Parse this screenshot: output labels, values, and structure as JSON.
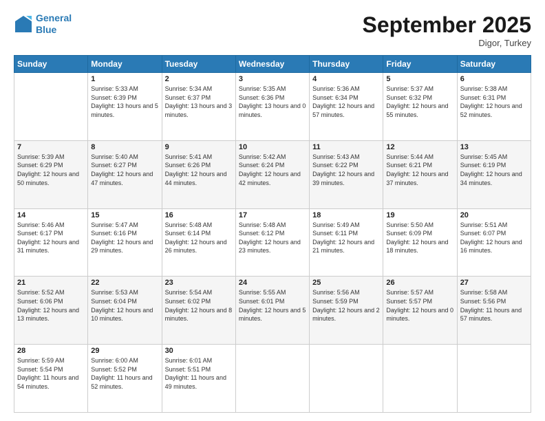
{
  "header": {
    "logo_line1": "General",
    "logo_line2": "Blue",
    "month": "September 2025",
    "location": "Digor, Turkey"
  },
  "weekdays": [
    "Sunday",
    "Monday",
    "Tuesday",
    "Wednesday",
    "Thursday",
    "Friday",
    "Saturday"
  ],
  "weeks": [
    [
      {
        "day": "",
        "sunrise": "",
        "sunset": "",
        "daylight": ""
      },
      {
        "day": "1",
        "sunrise": "Sunrise: 5:33 AM",
        "sunset": "Sunset: 6:39 PM",
        "daylight": "Daylight: 13 hours and 5 minutes."
      },
      {
        "day": "2",
        "sunrise": "Sunrise: 5:34 AM",
        "sunset": "Sunset: 6:37 PM",
        "daylight": "Daylight: 13 hours and 3 minutes."
      },
      {
        "day": "3",
        "sunrise": "Sunrise: 5:35 AM",
        "sunset": "Sunset: 6:36 PM",
        "daylight": "Daylight: 13 hours and 0 minutes."
      },
      {
        "day": "4",
        "sunrise": "Sunrise: 5:36 AM",
        "sunset": "Sunset: 6:34 PM",
        "daylight": "Daylight: 12 hours and 57 minutes."
      },
      {
        "day": "5",
        "sunrise": "Sunrise: 5:37 AM",
        "sunset": "Sunset: 6:32 PM",
        "daylight": "Daylight: 12 hours and 55 minutes."
      },
      {
        "day": "6",
        "sunrise": "Sunrise: 5:38 AM",
        "sunset": "Sunset: 6:31 PM",
        "daylight": "Daylight: 12 hours and 52 minutes."
      }
    ],
    [
      {
        "day": "7",
        "sunrise": "Sunrise: 5:39 AM",
        "sunset": "Sunset: 6:29 PM",
        "daylight": "Daylight: 12 hours and 50 minutes."
      },
      {
        "day": "8",
        "sunrise": "Sunrise: 5:40 AM",
        "sunset": "Sunset: 6:27 PM",
        "daylight": "Daylight: 12 hours and 47 minutes."
      },
      {
        "day": "9",
        "sunrise": "Sunrise: 5:41 AM",
        "sunset": "Sunset: 6:26 PM",
        "daylight": "Daylight: 12 hours and 44 minutes."
      },
      {
        "day": "10",
        "sunrise": "Sunrise: 5:42 AM",
        "sunset": "Sunset: 6:24 PM",
        "daylight": "Daylight: 12 hours and 42 minutes."
      },
      {
        "day": "11",
        "sunrise": "Sunrise: 5:43 AM",
        "sunset": "Sunset: 6:22 PM",
        "daylight": "Daylight: 12 hours and 39 minutes."
      },
      {
        "day": "12",
        "sunrise": "Sunrise: 5:44 AM",
        "sunset": "Sunset: 6:21 PM",
        "daylight": "Daylight: 12 hours and 37 minutes."
      },
      {
        "day": "13",
        "sunrise": "Sunrise: 5:45 AM",
        "sunset": "Sunset: 6:19 PM",
        "daylight": "Daylight: 12 hours and 34 minutes."
      }
    ],
    [
      {
        "day": "14",
        "sunrise": "Sunrise: 5:46 AM",
        "sunset": "Sunset: 6:17 PM",
        "daylight": "Daylight: 12 hours and 31 minutes."
      },
      {
        "day": "15",
        "sunrise": "Sunrise: 5:47 AM",
        "sunset": "Sunset: 6:16 PM",
        "daylight": "Daylight: 12 hours and 29 minutes."
      },
      {
        "day": "16",
        "sunrise": "Sunrise: 5:48 AM",
        "sunset": "Sunset: 6:14 PM",
        "daylight": "Daylight: 12 hours and 26 minutes."
      },
      {
        "day": "17",
        "sunrise": "Sunrise: 5:48 AM",
        "sunset": "Sunset: 6:12 PM",
        "daylight": "Daylight: 12 hours and 23 minutes."
      },
      {
        "day": "18",
        "sunrise": "Sunrise: 5:49 AM",
        "sunset": "Sunset: 6:11 PM",
        "daylight": "Daylight: 12 hours and 21 minutes."
      },
      {
        "day": "19",
        "sunrise": "Sunrise: 5:50 AM",
        "sunset": "Sunset: 6:09 PM",
        "daylight": "Daylight: 12 hours and 18 minutes."
      },
      {
        "day": "20",
        "sunrise": "Sunrise: 5:51 AM",
        "sunset": "Sunset: 6:07 PM",
        "daylight": "Daylight: 12 hours and 16 minutes."
      }
    ],
    [
      {
        "day": "21",
        "sunrise": "Sunrise: 5:52 AM",
        "sunset": "Sunset: 6:06 PM",
        "daylight": "Daylight: 12 hours and 13 minutes."
      },
      {
        "day": "22",
        "sunrise": "Sunrise: 5:53 AM",
        "sunset": "Sunset: 6:04 PM",
        "daylight": "Daylight: 12 hours and 10 minutes."
      },
      {
        "day": "23",
        "sunrise": "Sunrise: 5:54 AM",
        "sunset": "Sunset: 6:02 PM",
        "daylight": "Daylight: 12 hours and 8 minutes."
      },
      {
        "day": "24",
        "sunrise": "Sunrise: 5:55 AM",
        "sunset": "Sunset: 6:01 PM",
        "daylight": "Daylight: 12 hours and 5 minutes."
      },
      {
        "day": "25",
        "sunrise": "Sunrise: 5:56 AM",
        "sunset": "Sunset: 5:59 PM",
        "daylight": "Daylight: 12 hours and 2 minutes."
      },
      {
        "day": "26",
        "sunrise": "Sunrise: 5:57 AM",
        "sunset": "Sunset: 5:57 PM",
        "daylight": "Daylight: 12 hours and 0 minutes."
      },
      {
        "day": "27",
        "sunrise": "Sunrise: 5:58 AM",
        "sunset": "Sunset: 5:56 PM",
        "daylight": "Daylight: 11 hours and 57 minutes."
      }
    ],
    [
      {
        "day": "28",
        "sunrise": "Sunrise: 5:59 AM",
        "sunset": "Sunset: 5:54 PM",
        "daylight": "Daylight: 11 hours and 54 minutes."
      },
      {
        "day": "29",
        "sunrise": "Sunrise: 6:00 AM",
        "sunset": "Sunset: 5:52 PM",
        "daylight": "Daylight: 11 hours and 52 minutes."
      },
      {
        "day": "30",
        "sunrise": "Sunrise: 6:01 AM",
        "sunset": "Sunset: 5:51 PM",
        "daylight": "Daylight: 11 hours and 49 minutes."
      },
      {
        "day": "",
        "sunrise": "",
        "sunset": "",
        "daylight": ""
      },
      {
        "day": "",
        "sunrise": "",
        "sunset": "",
        "daylight": ""
      },
      {
        "day": "",
        "sunrise": "",
        "sunset": "",
        "daylight": ""
      },
      {
        "day": "",
        "sunrise": "",
        "sunset": "",
        "daylight": ""
      }
    ]
  ]
}
